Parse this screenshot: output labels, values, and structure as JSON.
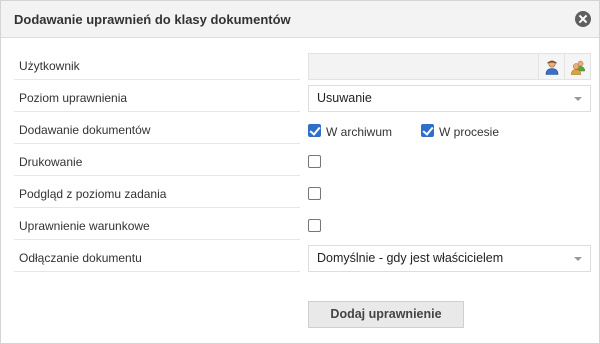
{
  "dialog": {
    "title": "Dodawanie uprawnień do klasy dokumentów",
    "close_icon": "close-circle-icon"
  },
  "form": {
    "user": {
      "label": "Użytkownik",
      "value": "",
      "select_icon": "person-icon",
      "group_icon": "group-icon"
    },
    "permission_level": {
      "label": "Poziom uprawnienia",
      "value": "Usuwanie"
    },
    "adding_documents": {
      "label": "Dodawanie dokumentów",
      "options": [
        {
          "label": "W archiwum",
          "checked": true
        },
        {
          "label": "W procesie",
          "checked": true
        }
      ]
    },
    "printing": {
      "label": "Drukowanie",
      "checked": false
    },
    "task_preview": {
      "label": "Podgląd z poziomu zadania",
      "checked": false
    },
    "conditional": {
      "label": "Uprawnienie warunkowe",
      "checked": false
    },
    "detaching": {
      "label": "Odłączanie dokumentu",
      "value": "Domyślnie - gdy jest właścicielem"
    }
  },
  "actions": {
    "add_label": "Dodaj uprawnienie"
  },
  "colors": {
    "accent": "#2f6fc8",
    "header_bg": "#f3f3f3"
  }
}
